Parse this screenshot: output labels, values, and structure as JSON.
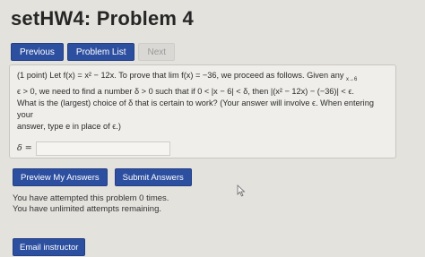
{
  "page": {
    "title": "setHW4: Problem 4"
  },
  "nav": {
    "previous_label": "Previous",
    "problem_list_label": "Problem List",
    "next_label": "Next"
  },
  "problem": {
    "text_line_1": "(1 point) Let f(x) = x² − 12x. To prove that lim f(x) = −36, we proceed as follows. Given any",
    "text_line_1_sub": "x→6",
    "text_line_2": "ϵ > 0, we need to find a number δ > 0 such that if 0 < |x − 6| < δ, then |(x² − 12x) − (−36)| < ϵ.",
    "text_line_3": "What is the (largest) choice of δ that is certain to work? (Your answer will involve ϵ. When entering your",
    "text_line_4": "answer, type e in place of ϵ.)",
    "answer_label": "δ =",
    "answer_value": ""
  },
  "actions": {
    "preview_label": "Preview My Answers",
    "submit_label": "Submit Answers"
  },
  "status": {
    "attempts_line": "You have attempted this problem 0 times.",
    "unlimited_line": "You have unlimited attempts remaining."
  },
  "footer": {
    "email_label": "Email instructor"
  },
  "colors": {
    "accent": "#2d4fa0",
    "background": "#e4e2dd"
  }
}
